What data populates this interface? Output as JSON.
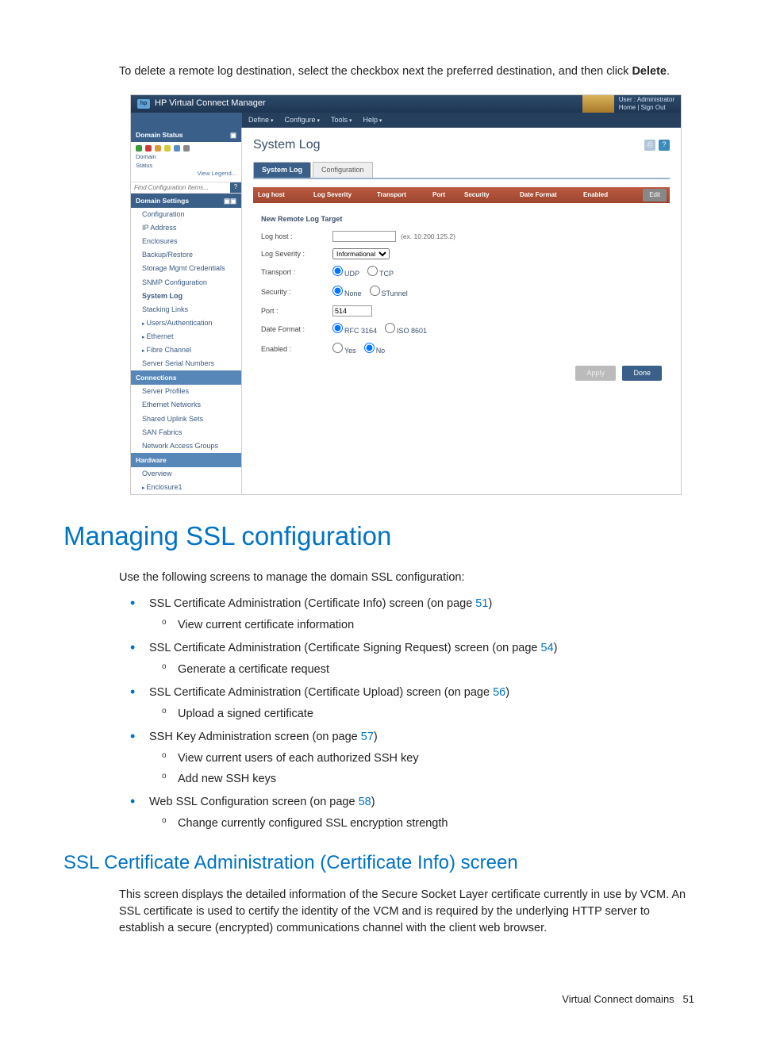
{
  "intro": {
    "prefix": "To delete a remote log destination, select the checkbox next the preferred destination, and then click ",
    "bold": "Delete",
    "suffix": "."
  },
  "app": {
    "top_title": "HP Virtual Connect Manager",
    "user_line1": "User : Administrator",
    "user_line2": "Home  |  Sign Out",
    "menus": [
      "Define",
      "Configure",
      "Tools",
      "Help"
    ]
  },
  "sidebar": {
    "domain_status_hdr": "Domain Status",
    "domain_label": "Domain",
    "status_label": "Status",
    "view_legend": "View Legend...",
    "search_placeholder": "Find Configuration Items...",
    "sections": [
      {
        "header": "Domain Settings",
        "items": [
          "Configuration",
          "IP Address",
          "Enclosures",
          "Backup/Restore",
          "Storage Mgmt Credentials",
          "SNMP Configuration",
          "System Log",
          "Stacking Links",
          "Users/Authentication",
          "Ethernet",
          "Fibre Channel",
          "Server Serial Numbers"
        ],
        "selected": "System Log"
      },
      {
        "header": "Connections",
        "items": [
          "Server Profiles",
          "Ethernet Networks",
          "Shared Uplink Sets",
          "SAN Fabrics",
          "Network Access Groups"
        ]
      },
      {
        "header": "Hardware",
        "items": [
          "Overview",
          "Enclosure1"
        ]
      }
    ]
  },
  "content": {
    "page_title": "System Log",
    "tabs": [
      "System Log",
      "Configuration"
    ],
    "active_tab": "System Log",
    "columns": [
      "Log host",
      "Log Severity",
      "Transport",
      "Port",
      "Security",
      "Date Format",
      "Enabled"
    ],
    "edit_btn": "Edit",
    "form_title": "New Remote Log Target",
    "fields": {
      "log_host": {
        "label": "Log host :",
        "hint": "(ex. 10.200.125.2)"
      },
      "severity": {
        "label": "Log Severity :",
        "option": "Informational"
      },
      "transport": {
        "label": "Transport :",
        "opts": [
          "UDP",
          "TCP"
        ],
        "selected": "UDP"
      },
      "security": {
        "label": "Security :",
        "opts": [
          "None",
          "STunnel"
        ],
        "selected": "None"
      },
      "port": {
        "label": "Port :",
        "value": "514"
      },
      "date_format": {
        "label": "Date Format :",
        "opts": [
          "RFC 3164",
          "ISO 8601"
        ],
        "selected": "RFC 3164"
      },
      "enabled": {
        "label": "Enabled :",
        "opts": [
          "Yes",
          "No"
        ],
        "selected": "No"
      }
    },
    "buttons": {
      "apply": "Apply",
      "done": "Done"
    }
  },
  "doc": {
    "h1": "Managing SSL configuration",
    "para1": "Use the following screens to manage the domain SSL configuration:",
    "items": [
      {
        "text_before": "SSL Certificate Administration (Certificate Info) screen (on page ",
        "link": "51",
        "text_after": ")",
        "subs": [
          "View current certificate information"
        ]
      },
      {
        "text_before": "SSL Certificate Administration (Certificate Signing Request) screen (on page ",
        "link": "54",
        "text_after": ")",
        "subs": [
          "Generate a certificate request"
        ]
      },
      {
        "text_before": "SSL Certificate Administration (Certificate Upload) screen (on page ",
        "link": "56",
        "text_after": ")",
        "subs": [
          "Upload a signed certificate"
        ]
      },
      {
        "text_before": "SSH Key Administration screen (on page ",
        "link": "57",
        "text_after": ")",
        "subs": [
          "View current users of each authorized SSH key",
          "Add new SSH keys"
        ]
      },
      {
        "text_before": "Web SSL Configuration screen (on page ",
        "link": "58",
        "text_after": ")",
        "subs": [
          "Change currently configured SSL encryption strength"
        ]
      }
    ],
    "h2": "SSL Certificate Administration (Certificate Info) screen",
    "para2": "This screen displays the detailed information of the Secure Socket Layer certificate currently in use by VCM. An SSL certificate is used to certify the identity of the VCM and is required by the underlying HTTP server to establish a secure (encrypted) communications channel with the client web browser."
  },
  "footer": {
    "text": "Virtual Connect domains",
    "page": "51"
  }
}
